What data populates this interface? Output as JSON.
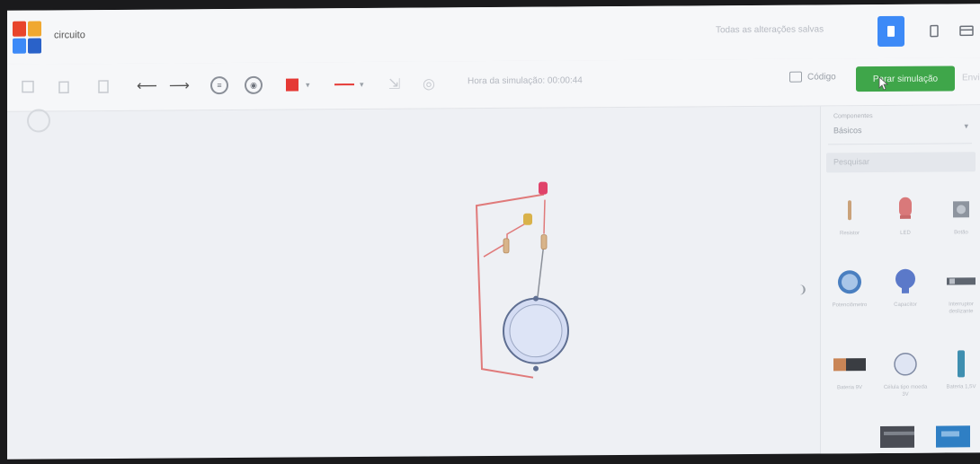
{
  "header": {
    "app_title": "circuito",
    "saved_status": "Todas as alterações salvas",
    "logo_colors": [
      "#e8452c",
      "#f0a830",
      "#3d8af7",
      "#2a62c9"
    ]
  },
  "toolbar": {
    "sim_time": "Hora da simulação: 00:00:44",
    "code_label": "Código",
    "start_label": "Parar simulação",
    "export_label": "Enviar",
    "wire_color": "#e53935"
  },
  "panel": {
    "components_label": "Componentes",
    "components_value": "Básicos",
    "search_placeholder": "Pesquisar",
    "items": [
      {
        "label": "Resistor"
      },
      {
        "label": "LED"
      },
      {
        "label": "Botão"
      },
      {
        "label": "Potenciômetro"
      },
      {
        "label": "Capacitor"
      },
      {
        "label": "Interruptor deslizante"
      },
      {
        "label": "Bateria 9V"
      },
      {
        "label": "Célula tipo moeda 3V"
      },
      {
        "label": "Bateria 1,5V"
      }
    ]
  },
  "colors": {
    "accent": "#3d8af7",
    "start_button": "#3fa64a",
    "wire": "#e07a7a"
  }
}
